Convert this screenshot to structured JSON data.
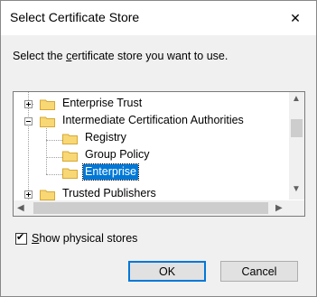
{
  "window": {
    "title": "Select Certificate Store"
  },
  "prompt": {
    "before": "Select the ",
    "underline": "c",
    "after": "ertificate store you want to use."
  },
  "tree": {
    "items": [
      {
        "label": "Enterprise Trust",
        "expander": "plus"
      },
      {
        "label": "Intermediate Certification Authorities",
        "expander": "minus"
      },
      {
        "label": "Registry"
      },
      {
        "label": "Group Policy"
      },
      {
        "label": "Enterprise",
        "selected": true
      },
      {
        "label": "Trusted Publishers",
        "expander": "plus"
      }
    ]
  },
  "scroll": {
    "up": "▲",
    "down": "▼",
    "left": "◀",
    "right": "▶"
  },
  "checkbox": {
    "label_underline": "S",
    "label_rest": "how physical stores",
    "checked": true,
    "check_glyph": "✔"
  },
  "buttons": {
    "ok": "OK",
    "cancel": "Cancel"
  },
  "close_glyph": "✕"
}
